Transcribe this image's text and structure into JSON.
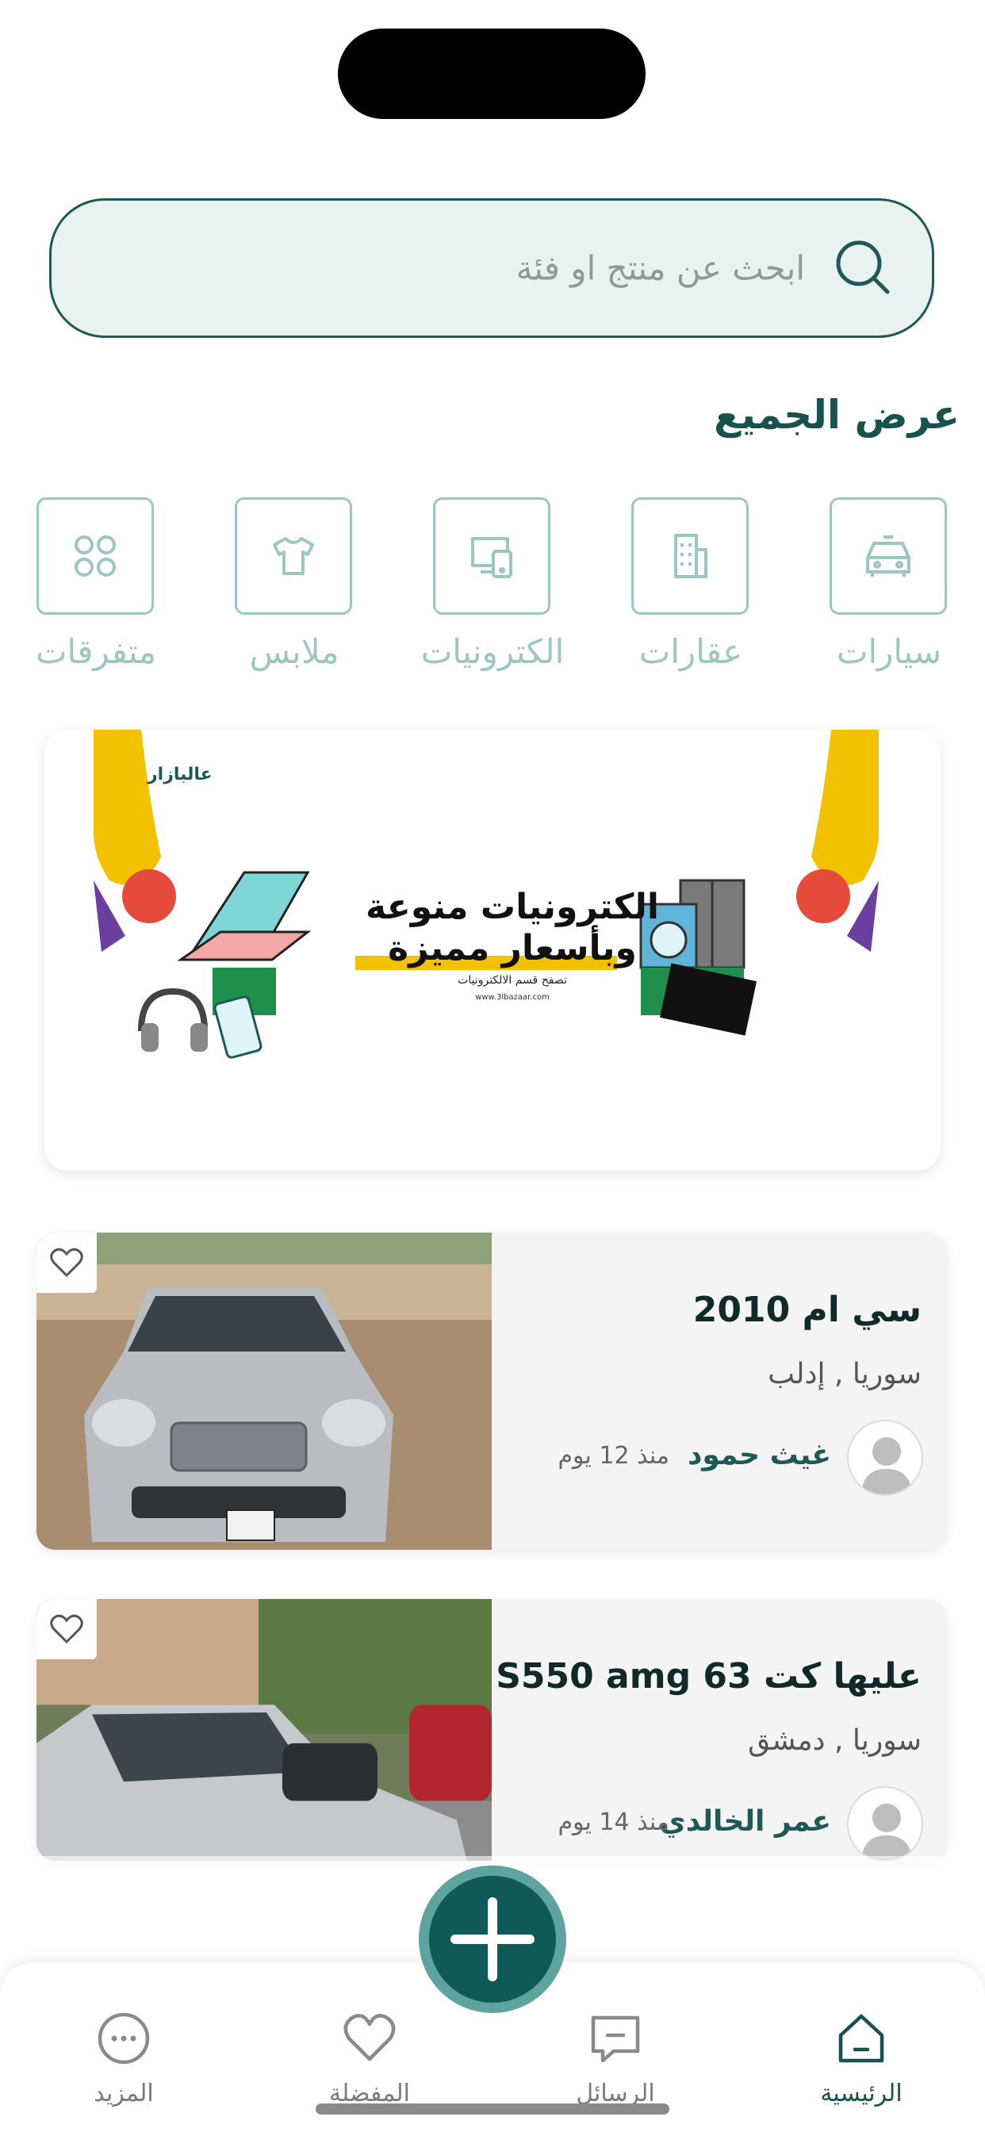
{
  "search": {
    "placeholder": "ابحث عن منتج او فئة",
    "icon": "search-icon"
  },
  "categories": {
    "see_all": "عرض الجميع",
    "items": [
      {
        "label": "سيارات",
        "icon": "car-icon"
      },
      {
        "label": "عقارات",
        "icon": "building-icon"
      },
      {
        "label": "الكترونيات",
        "icon": "devices-icon"
      },
      {
        "label": "ملابس",
        "icon": "shirt-icon"
      },
      {
        "label": "متفرقات",
        "icon": "grid-icon"
      }
    ]
  },
  "banner": {
    "brand": "عالبازار",
    "headline_line1": "الكترونيات منوعة",
    "headline_line2": "وبأسعار مميزة",
    "subtitle": "تصفح قسم الالكترونيات",
    "url": "www.3lbazaar.com"
  },
  "listings": [
    {
      "title": "سي ام 2010",
      "location": "سوريا , إدلب",
      "seller": "غيث حمود",
      "time": "منذ 12 يوم"
    },
    {
      "title": "عليها كت S550 amg 63",
      "location": "سوريا , دمشق",
      "seller": "عمر الخالدي",
      "time": "منذ 14 يوم"
    }
  ],
  "tabbar": {
    "items": [
      {
        "label": "الرئيسية",
        "icon": "home-icon",
        "active": true
      },
      {
        "label": "الرسائل",
        "icon": "message-icon",
        "active": false
      },
      {
        "label": "المفضلة",
        "icon": "heart-icon",
        "active": false
      },
      {
        "label": "المزيد",
        "icon": "more-icon",
        "active": false
      }
    ]
  },
  "colors": {
    "primary": "#17524f",
    "accent_light": "#9cc6c1",
    "search_bg": "#e9f2f0",
    "fab": "#0f5a57"
  }
}
